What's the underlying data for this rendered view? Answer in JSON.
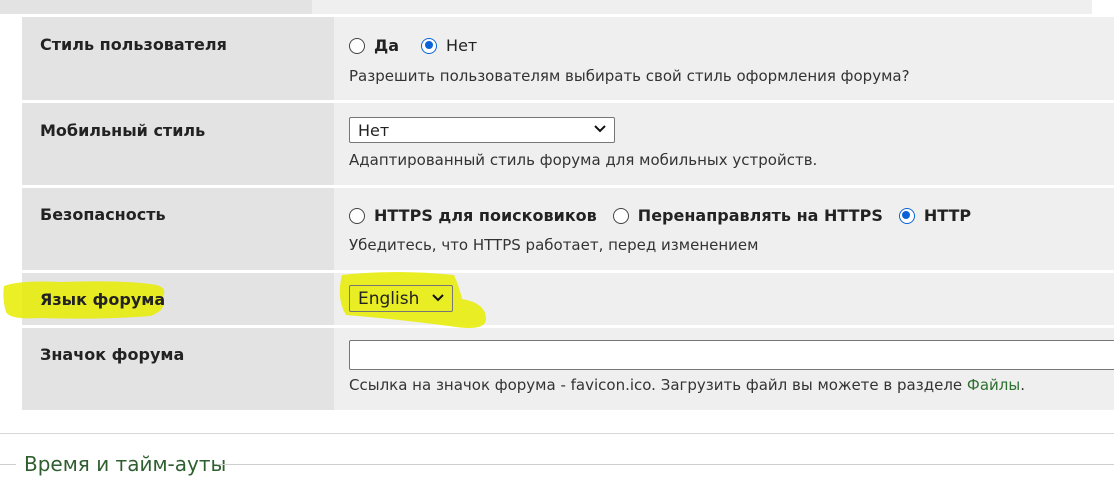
{
  "rows": [
    {
      "label": "Стиль пользователя",
      "type": "radio",
      "options": [
        {
          "label": "Да",
          "checked": false,
          "bold": true
        },
        {
          "label": "Нет",
          "checked": true,
          "bold": false
        }
      ],
      "description": "Разрешить пользователям выбирать свой стиль оформления форума?"
    },
    {
      "label": "Мобильный стиль",
      "type": "select",
      "selected": "Нет",
      "description": "Адаптированный стиль форума для мобильных устройств."
    },
    {
      "label": "Безопасность",
      "type": "radio",
      "options": [
        {
          "label": "HTTPS для поисковиков",
          "checked": false,
          "bold": true
        },
        {
          "label": "Перенаправлять на HTTPS",
          "checked": false,
          "bold": true
        },
        {
          "label": "HTTP",
          "checked": true,
          "bold": true
        }
      ],
      "description": "Убедитесь, что HTTPS работает, перед изменением"
    },
    {
      "label": "Язык форума",
      "type": "select",
      "selected": "English",
      "highlighted": true
    },
    {
      "label": "Значок форума",
      "type": "text",
      "value": "",
      "description": "Ссылка на значок форума - favicon.ico. Загрузить файл вы можете в разделе ",
      "description_link": "Файлы",
      "description_end": "."
    }
  ],
  "next_section": {
    "legend": "Время и тайм-ауты"
  },
  "colors": {
    "highlight": "#e8ec00",
    "radio_checked": "#0a64d8",
    "link": "#2f6f2f",
    "legend": "#2f5f2f"
  },
  "icons": {
    "select_arrow": "chevron-down-icon"
  }
}
